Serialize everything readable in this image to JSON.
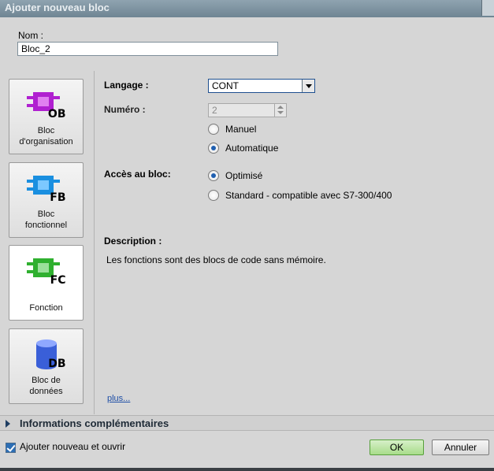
{
  "window": {
    "title": "Ajouter nouveau bloc"
  },
  "name_field": {
    "label": "Nom :",
    "value": "Bloc_2"
  },
  "blocks": [
    {
      "code": "OB",
      "label_line1": "Bloc",
      "label_line2": "d'organisation",
      "color": "#b020d0",
      "selected": false
    },
    {
      "code": "FB",
      "label_line1": "Bloc",
      "label_line2": "fonctionnel",
      "color": "#1a8fe0",
      "selected": false
    },
    {
      "code": "FC",
      "label_line1": "",
      "label_line2": "Fonction",
      "color": "#2fb02f",
      "selected": true
    },
    {
      "code": "DB",
      "label_line1": "Bloc de",
      "label_line2": "données",
      "color": "#3a5fd8",
      "selected": false
    }
  ],
  "form": {
    "language_label": "Langage :",
    "language_value": "CONT",
    "number_label": "Numéro :",
    "number_value": "2",
    "number_modes": {
      "manual": "Manuel",
      "automatic": "Automatique",
      "selected": "automatic"
    },
    "access_label": "Accès au bloc:",
    "access_options": {
      "optimized": "Optimisé",
      "standard": "Standard - compatible avec S7-300/400",
      "selected": "optimized"
    },
    "description_label": "Description :",
    "description_text": "Les fonctions sont des blocs de code sans mémoire.",
    "more_link": "plus..."
  },
  "info_bar": {
    "label": "Informations complémentaires"
  },
  "footer": {
    "add_open_label": "Ajouter nouveau et ouvrir",
    "add_open_checked": true,
    "ok_label": "OK",
    "cancel_label": "Annuler"
  },
  "colors": {
    "accent": "#1f5fb0",
    "ok_button": "#a8dc8a"
  }
}
